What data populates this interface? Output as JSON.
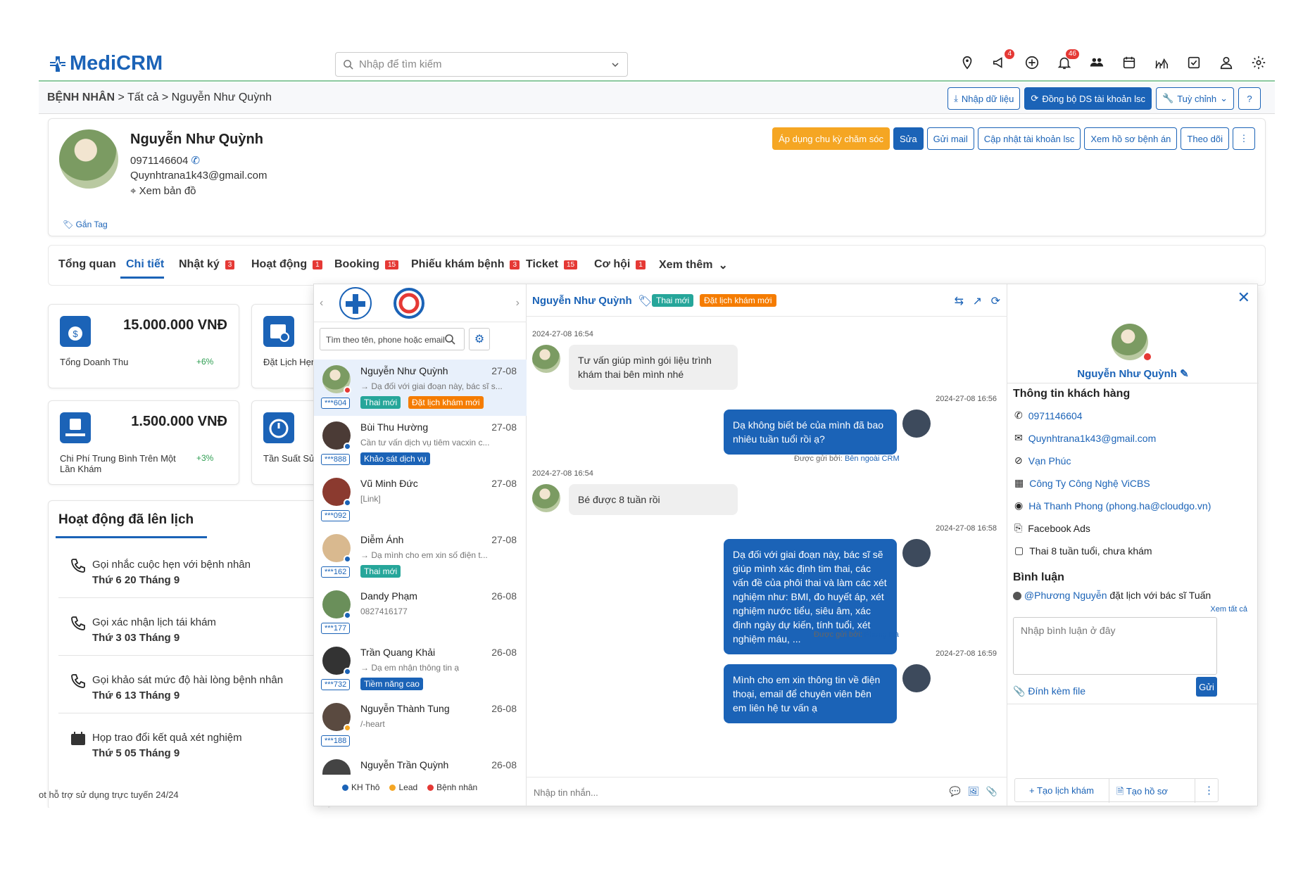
{
  "app": {
    "logo_main": "Medi",
    "logo_accent": "CRM",
    "search_placeholder": "Nhập để tìm kiếm"
  },
  "topbar_badges": {
    "megaphone": "4",
    "bell": "46"
  },
  "breadcrumb": {
    "root": "BỆNH NHÂN",
    "level2": "Tất cả",
    "current": "Nguyễn Như Quỳnh"
  },
  "header_buttons": {
    "import": "Nhập dữ liệu",
    "sync": "Đồng bộ DS tài khoản lsc",
    "customize": "Tuỳ chỉnh"
  },
  "profile": {
    "name": "Nguyễn Như Quỳnh",
    "phone": "0971146604",
    "email": "Quynhtrana1k43@gmail.com",
    "map": "Xem bản đồ",
    "tag": "Gắn Tag",
    "buttons": {
      "apply": "Áp dụng chu kỳ chăm sóc",
      "edit": "Sửa",
      "mail": "Gửi mail",
      "update": "Cập nhật tài khoản lsc",
      "records": "Xem hồ sơ bệnh án",
      "follow": "Theo dõi"
    }
  },
  "tabs": [
    {
      "label": "Tổng quan",
      "count": ""
    },
    {
      "label": "Chi tiết",
      "count": ""
    },
    {
      "label": "Nhật ký",
      "count": "3"
    },
    {
      "label": "Hoạt động",
      "count": "1"
    },
    {
      "label": "Booking",
      "count": "15"
    },
    {
      "label": "Phiếu khám bệnh",
      "count": "3"
    },
    {
      "label": "Ticket",
      "count": "15"
    },
    {
      "label": "Cơ hội",
      "count": "1"
    },
    {
      "label": "Xem thêm",
      "count": ""
    }
  ],
  "stats": [
    {
      "value": "15.000.000 VNĐ",
      "label": "Tổng Doanh Thu",
      "pct": "+6%"
    },
    {
      "value": "",
      "label": "Đặt Lịch Hẹn",
      "pct": ""
    },
    {
      "value": "1.500.000 VNĐ",
      "label": "Chi Phí Trung Bình Trên Một Lần Khám",
      "pct": "+3%"
    },
    {
      "value": "",
      "label": "Tần Suất Sử D",
      "pct": ""
    }
  ],
  "schedule": {
    "title": "Hoạt động đã lên lịch",
    "items": [
      {
        "subject": "Gọi nhắc cuộc hẹn với bệnh nhân",
        "date": "Thứ 6 20 Tháng 9"
      },
      {
        "subject": "Gọi xác nhận lịch tái khám",
        "date": "Thứ 3 03 Tháng 9"
      },
      {
        "subject": "Gọi khảo sát mức độ hài lòng bệnh nhân",
        "date": "Thứ 6 13 Tháng 9"
      },
      {
        "subject": "Họp trao đổi kết quả xét nghiệm",
        "date": "Thứ 5 05 Tháng 9"
      }
    ]
  },
  "footer": "ot hỗ trợ sử dụng trực tuyến 24/24",
  "chat": {
    "search_placeholder": "Tìm theo tên, phone hoặc email",
    "conversations": [
      {
        "name": "Nguyễn Như Quỳnh",
        "date": "27-08",
        "preview": "→ Dạ đối với giai đoạn này, bác sĩ s...",
        "id": "***604",
        "tags": [
          "Thai mới",
          "Đặt lịch khám mới"
        ]
      },
      {
        "name": "Bùi Thu Hường",
        "date": "27-08",
        "preview": "Cần tư vấn dịch vụ tiêm vacxin c...",
        "id": "***888",
        "tags": [
          "Khảo sát dịch vụ"
        ]
      },
      {
        "name": "Vũ Minh Đức",
        "date": "27-08",
        "preview": "[Link]",
        "id": "***092",
        "tags": []
      },
      {
        "name": "Diễm Ánh",
        "date": "27-08",
        "preview": "→ Dạ mình cho em xin số điện t...",
        "id": "***162",
        "tags": [
          "Thai mới"
        ]
      },
      {
        "name": "Dandy Phạm",
        "date": "26-08",
        "preview": "0827416177",
        "id": "***177",
        "tags": []
      },
      {
        "name": "Trần Quang Khải",
        "date": "26-08",
        "preview": "→ Dạ em nhận thông tin ạ",
        "id": "***732",
        "tags": [
          "Tiềm năng cao"
        ]
      },
      {
        "name": "Nguyễn Thành Tung",
        "date": "26-08",
        "preview": "/-heart",
        "id": "***188",
        "tags": []
      },
      {
        "name": "Nguyễn Trần Quỳnh",
        "date": "26-08",
        "preview": "",
        "id": "",
        "tags": []
      }
    ],
    "legend": [
      "KH Thô",
      "Lead",
      "Bệnh nhân"
    ],
    "legend_colors": [
      "#1b63b7",
      "#f5a623",
      "#e53935"
    ],
    "header": {
      "name": "Nguyễn Như Quỳnh",
      "tag1": "Thai mới",
      "tag2": "Đặt lịch khám mới"
    },
    "messages": {
      "ts1": "2024-27-08 16:54",
      "m1": "Tư vấn giúp mình gói liệu trình khám thai bên mình nhé",
      "ts2": "2024-27-08 16:56",
      "m2": "Dạ không biết bé của mình đã bao nhiêu tuần tuổi rồi ạ?",
      "sent2_label": "Được gửi bởi:",
      "sent2_by": "Bên ngoài CRM",
      "ts3": "2024-27-08 16:54",
      "m3": "Bé được 8 tuần rồi",
      "ts4": "2024-27-08 16:58",
      "m4": "Dạ đối với giai đoạn này, bác sĩ sẽ giúp mình xác định tim thai, các vấn đề của phôi thai và làm các xét nghiệm như: BMI, đo huyết áp, xét nghiệm nước tiểu, siêu âm, xác định ngày dự kiến, tính tuổi, xét nghiệm máu, ...",
      "sent4_label": "Được gửi bởi:",
      "sent4_by": "Phong Hà",
      "ts5": "2024-27-08 16:59",
      "m5": "Mình cho em xin thông tin về điện thoại, email để chuyên viên bên em liên hệ tư vấn ạ"
    },
    "compose_placeholder": "Nhập tin nhắn..."
  },
  "customer": {
    "name": "Nguyễn Như Quỳnh",
    "section_title": "Thông tin khách hàng",
    "phone": "0971146604",
    "email": "Quynhtrana1k43@gmail.com",
    "location": "Vạn Phúc",
    "company": "Công Ty Công Nghệ ViCBS",
    "owner": "Hà Thanh Phong (phong.ha@cloudgo.vn)",
    "source": "Facebook Ads",
    "note": "Thai 8 tuần tuổi, chưa khám",
    "comments_title": "Bình luận",
    "comment_user": "@Phương Nguyễn",
    "comment_text": "đặt lịch với bác sĩ Tuấn",
    "see_all": "Xem tất cả",
    "comment_placeholder": "Nhập bình luận ở đây",
    "attach": "Đính kèm file",
    "send": "Gửi",
    "create_appt": "Tạo lịch khám",
    "create_record": "Tạo hồ sơ"
  }
}
